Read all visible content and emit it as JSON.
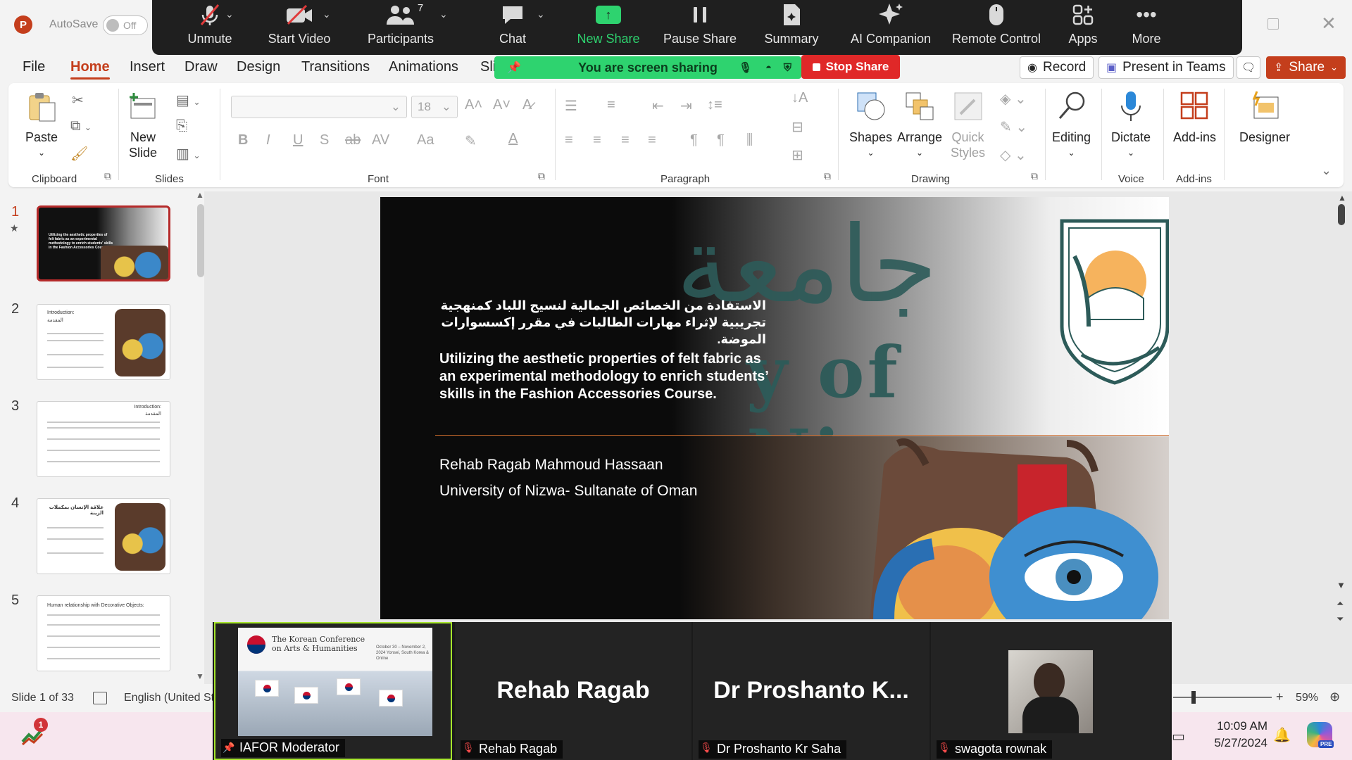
{
  "titlebar": {
    "autosave_label": "AutoSave",
    "autosave_state": "Off"
  },
  "zoom_toolbar": {
    "unmute": "Unmute",
    "start_video": "Start Video",
    "participants": "Participants",
    "participant_count": "7",
    "chat": "Chat",
    "new_share": "New Share",
    "pause_share": "Pause Share",
    "summary": "Summary",
    "ai_companion": "AI Companion",
    "remote_control": "Remote Control",
    "apps": "Apps",
    "more": "More"
  },
  "tabs": [
    "File",
    "Home",
    "Insert",
    "Draw",
    "Design",
    "Transitions",
    "Animations",
    "Sli"
  ],
  "sharing": {
    "banner": "You are screen sharing",
    "stop": "Stop Share"
  },
  "right_buttons": {
    "record": "Record",
    "present_teams": "Present in Teams",
    "share": "Share"
  },
  "ribbon": {
    "paste": "Paste",
    "clipboard": "Clipboard",
    "new_slide_line1": "New",
    "new_slide_line2": "Slide",
    "slides": "Slides",
    "font_size": "18",
    "font": "Font",
    "paragraph": "Paragraph",
    "shapes": "Shapes",
    "arrange": "Arrange",
    "quick_styles_line1": "Quick",
    "quick_styles_line2": "Styles",
    "drawing": "Drawing",
    "editing": "Editing",
    "dictate": "Dictate",
    "voice": "Voice",
    "addins": "Add-ins",
    "addins_group": "Add-ins",
    "designer": "Designer"
  },
  "thumbnails": [
    {
      "num": "1",
      "title": "Utilizing the aesthetic properties of felt fabric as an experimental methodology to enrich students' skills in the Fashion Accessories Course."
    },
    {
      "num": "2",
      "title": "Introduction:",
      "subtitle": "المقدمة"
    },
    {
      "num": "3",
      "title": "Introduction:",
      "subtitle": "المقدمة"
    },
    {
      "num": "4",
      "title": "علاقة الإنسان بمكملات الزينة"
    },
    {
      "num": "5",
      "title": "Human relationship with Decorative Objects:"
    }
  ],
  "slide": {
    "watermark_arabic": "جامعة",
    "watermark_latin": "y of Nizwa",
    "title_ar": "الاستفادة من الخصائص الجمالية لنسيج اللباد كمنهجية تجريبية لإثراء مهارات الطالبات في مقرر إكسسوارات الموضة.",
    "title_en": "Utilizing the aesthetic properties of felt fabric as an experimental methodology to enrich students’ skills in the Fashion Accessories Course.",
    "author": "Rehab Ragab Mahmoud Hassaan",
    "affiliation": "University of Nizwa- Sultanate of Oman"
  },
  "participants": [
    {
      "name": "IAFOR Moderator",
      "big": ""
    },
    {
      "name": "Rehab Ragab",
      "big": "Rehab Ragab"
    },
    {
      "name": "Dr Proshanto Kr Saha",
      "big": "Dr  Proshanto  K..."
    },
    {
      "name": "swagota rownak",
      "big": ""
    }
  ],
  "moderator_slide": {
    "title": "The Korean Conference on Arts & Humanities",
    "dates": "October 30 – November 2, 2024 Yonsei, South Korea & Online"
  },
  "statusbar": {
    "slide_count": "Slide 1 of 33",
    "language": "English (United St",
    "zoom": "59%"
  },
  "taskbar": {
    "badge": "1",
    "time": "10:09 AM",
    "date": "5/27/2024",
    "copilot_badge": "PRE"
  },
  "colors": {
    "accent": "#c43e1c",
    "share_green": "#2ed36f",
    "stop_red": "#e02828",
    "active_speaker": "#a6e62b"
  }
}
